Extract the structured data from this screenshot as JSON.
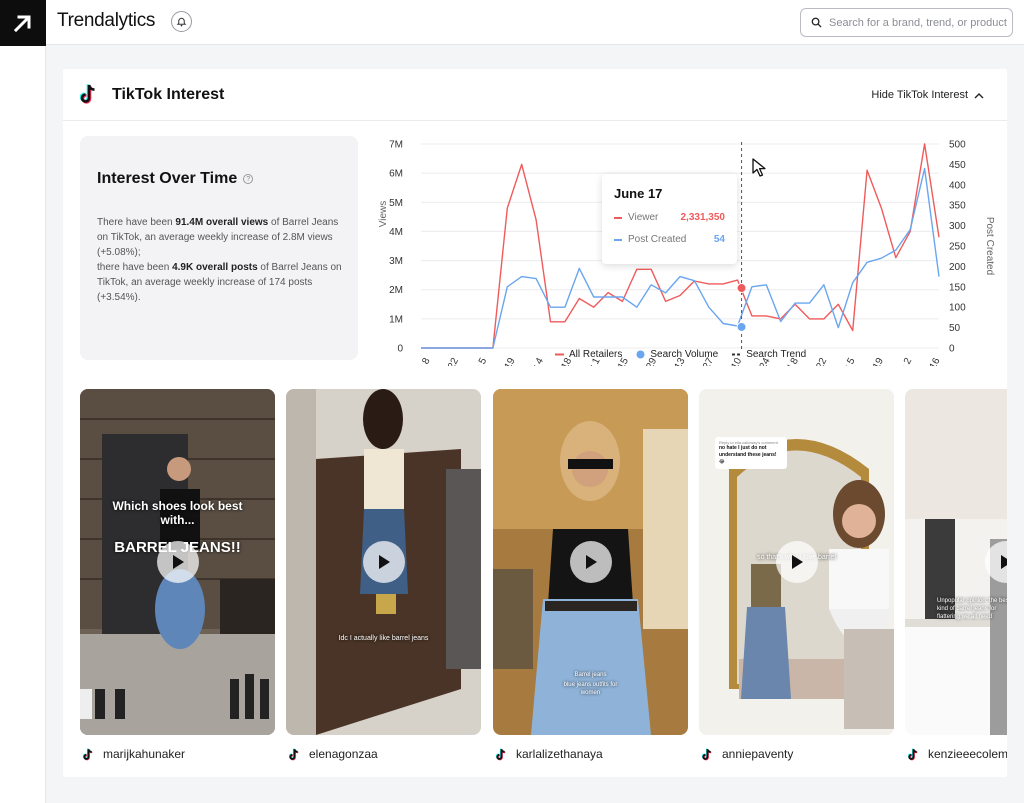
{
  "app": {
    "brand": "Trendalytics",
    "search_placeholder": "Search for a brand, trend, or product"
  },
  "section": {
    "title": "TikTok Interest",
    "hide_label": "Hide TikTok Interest"
  },
  "info": {
    "title": "Interest Over Time",
    "p1": "There have been ",
    "p1b": "91.4M overall views",
    "p2": " of Barrel Jeans on TikTok, an average weekly increase of 2.8M views (+5.08%);",
    "p3": "there have been ",
    "p3b": "4.9K overall posts",
    "p4": " of Barrel Jeans on TikTok, an average weekly increase of 174 posts (+3.54%)."
  },
  "tooltip": {
    "date": "June 17",
    "viewer_label": "Viewer",
    "viewer_value": "2,331,350",
    "post_label": "Post Created",
    "post_value": "54"
  },
  "legend": {
    "all": "All Retailers",
    "search": "Search Volume",
    "trend": "Search Trend"
  },
  "colors": {
    "views": "#ef5b5b",
    "posts": "#6aa6ef",
    "trend": "#555555"
  },
  "chart_data": {
    "type": "line",
    "ylabel": "Views",
    "y2label": "Post Created",
    "ylim": [
      0,
      7000000
    ],
    "y2lim": [
      0,
      500
    ],
    "y_ticks": [
      "0",
      "1M",
      "2M",
      "3M",
      "4M",
      "5M",
      "6M",
      "7M"
    ],
    "y2_ticks": [
      "0",
      "50",
      "100",
      "150",
      "200",
      "250",
      "300",
      "350",
      "400",
      "450",
      "500"
    ],
    "x_ticks": [
      "Jan 8",
      "Jan 22",
      "Feb 5",
      "Feb 19",
      "Mar 4",
      "Mar 18",
      "Apr 1",
      "Apr 15",
      "Apr 29",
      "May 13",
      "May 27",
      "Jun 10",
      "Jun 24",
      "Jul 8",
      "Jul 22",
      "Aug 5",
      "Aug 19",
      "Sep 2",
      "Sep 16"
    ],
    "highlight_index": 22,
    "series": [
      {
        "name": "Viewer",
        "axis": "left",
        "values": [
          0,
          0,
          0,
          0,
          0,
          0,
          4800000,
          6300000,
          4400000,
          900000,
          900000,
          1700000,
          1400000,
          1900000,
          1600000,
          2700000,
          2700000,
          1600000,
          1800000,
          2300000,
          2200000,
          2200000,
          2331350,
          1100000,
          1100000,
          1000000,
          1500000,
          1000000,
          1000000,
          1500000,
          600000,
          6100000,
          4800000,
          3100000,
          4000000,
          7000000,
          3800000
        ]
      },
      {
        "name": "Post Created",
        "axis": "right",
        "values": [
          0,
          0,
          0,
          0,
          0,
          0,
          150,
          175,
          170,
          100,
          100,
          195,
          125,
          125,
          125,
          100,
          155,
          135,
          175,
          165,
          100,
          60,
          54,
          150,
          155,
          65,
          110,
          110,
          155,
          50,
          160,
          210,
          220,
          240,
          290,
          440,
          175
        ]
      }
    ]
  },
  "videos": [
    {
      "author": "marijkahunaker",
      "caption_top": "Which shoes look best with...",
      "caption_big": "BARREL JEANS!!"
    },
    {
      "author": "elenagonzaa",
      "caption": "Idc I actually like barrel jeans"
    },
    {
      "author": "karlalizethanaya",
      "caption": "Barrel jeans",
      "caption2": "blue jeans outfits for women"
    },
    {
      "author": "anniepaventy",
      "bubble_small": "Reply to ella.calloway's comment",
      "bubble": "no hate I just do not understand these jeans! 😂",
      "caption": "so that's why I love barrel"
    },
    {
      "author": "kenzieeecolem",
      "caption": "Unpopular opinion: the best kind of barrel jeans for flattering we all need"
    }
  ]
}
